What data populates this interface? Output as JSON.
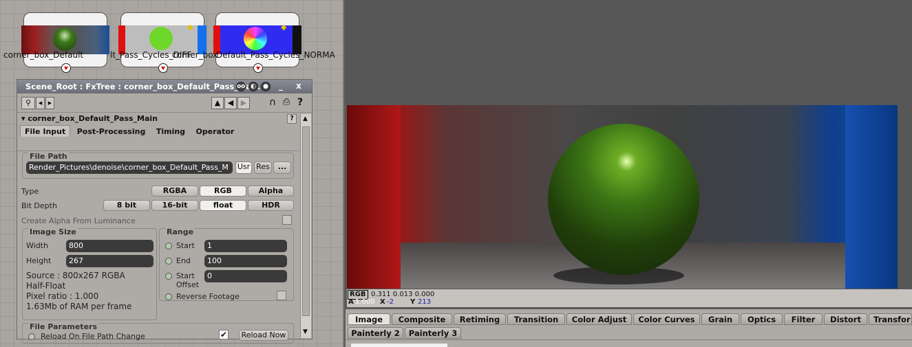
{
  "graph": {
    "nodes": [
      {
        "label": "corner_box_Default_Pass_Main"
      },
      {
        "label": "Default_Pass_Cycles_DIFFUSE"
      },
      {
        "label": "Default_Pass_Cycles_NORMA"
      }
    ],
    "overlap_labels": [
      "corner_box_Default",
      "lt_Pass_Cycles_DIFF",
      "corner_box",
      "er_Pass_Ma"
    ]
  },
  "panel": {
    "title": "Scene_Root : FxTree : corner_box_Default_Pass_Ma...",
    "minimize": "_",
    "close": "x",
    "property_title": "corner_box_Default_Pass_Main",
    "help": "?",
    "tabs": [
      "File Input",
      "Post-Processing",
      "Timing",
      "Operator"
    ],
    "file_path": {
      "group": "File Path",
      "value": "Render_Pictures\\denoise\\corner_box_Default_Pass_M",
      "usr": "Usr",
      "res": "Res",
      "browse": "..."
    },
    "type": {
      "label": "Type",
      "options": [
        "RGBA",
        "RGB",
        "Alpha"
      ],
      "selected": "RGB"
    },
    "bit_depth": {
      "label": "Bit Depth",
      "options": [
        "8 bit",
        "16-bit",
        "float",
        "HDR"
      ],
      "selected": "float"
    },
    "alpha_lum": "Create Alpha From Luminance",
    "image_size": {
      "group": "Image Size",
      "width_label": "Width",
      "width": "800",
      "height_label": "Height",
      "height": "267",
      "source": "Source  : 800x267 RGBA",
      "half_float": "Half-Float",
      "pixel_ratio": "Pixel ratio : 1.000",
      "ram": "1.63Mb of RAM per frame"
    },
    "range": {
      "group": "Range",
      "start_label": "Start",
      "start": "1",
      "end_label": "End",
      "end": "100",
      "offset_label_1": "Start",
      "offset_label_2": "Offset",
      "offset": "0",
      "reverse": "Reverse Footage"
    },
    "file_params": {
      "group": "File Parameters",
      "reload_change": "Reload On File Path Change",
      "reload_checked": true,
      "reload_now": "Reload Now"
    }
  },
  "viewer": {
    "info": {
      "mode": "RGB",
      "values": "0.311   0.013   0.000",
      "a_label": "A",
      "a_value": "1.000",
      "x_label": "X",
      "x_value": "-2",
      "y_label": "Y",
      "y_value": "213"
    },
    "tabs_row1": [
      "Image",
      "Composite",
      "Retiming",
      "Transition",
      "Color Adjust",
      "Color Curves",
      "Grain",
      "Optics",
      "Filter",
      "Distort",
      "Transfor"
    ],
    "tabs_row2": [
      "Painterly 2",
      "Painterly 3"
    ],
    "active_tab": "Image"
  }
}
